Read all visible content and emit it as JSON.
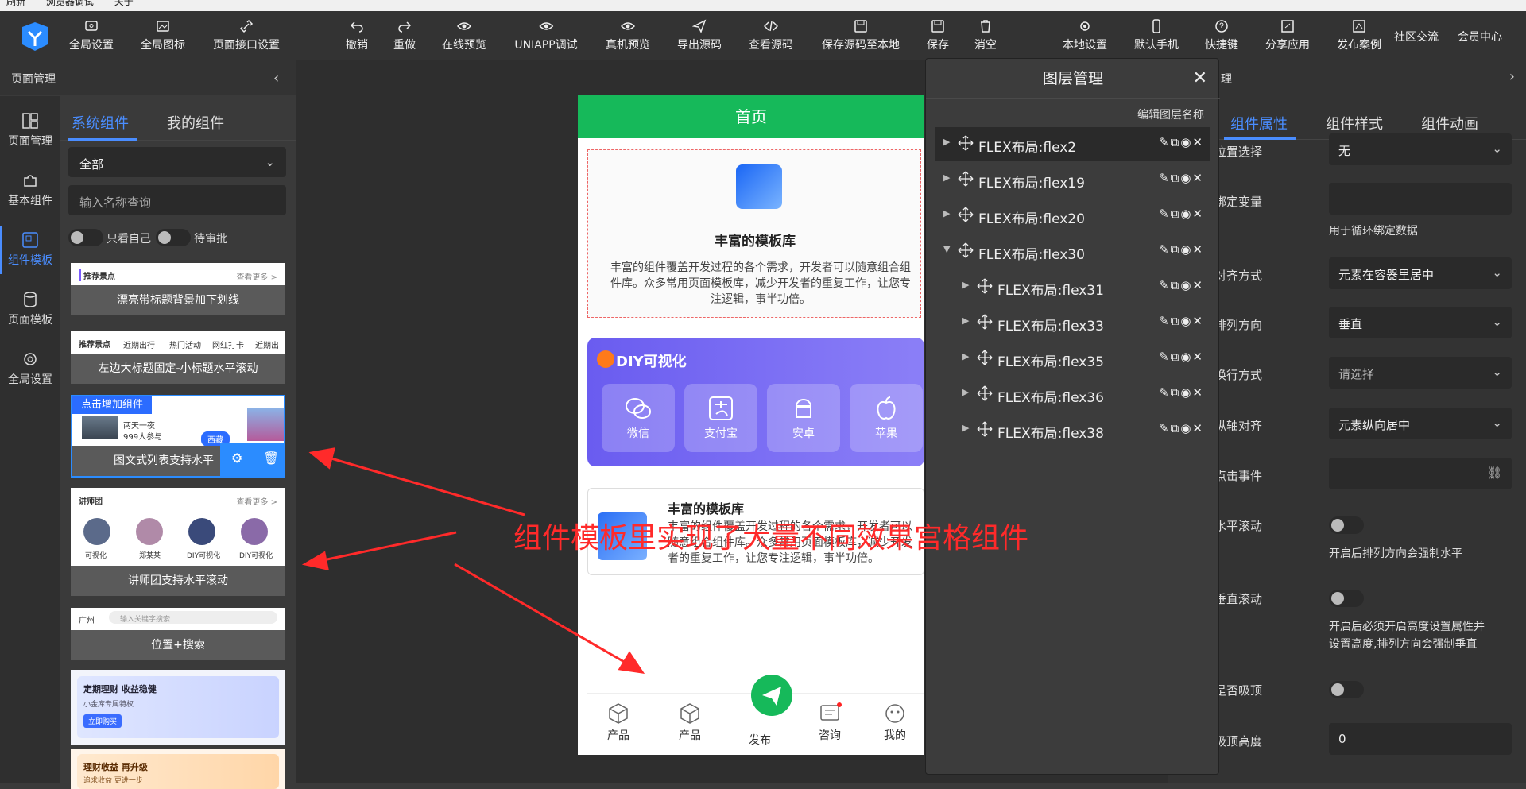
{
  "menubar": {
    "items": [
      "刷新",
      "浏览器调试",
      "关于"
    ]
  },
  "toolbar": {
    "left": [
      "全局设置",
      "全局图标",
      "页面接口设置"
    ],
    "center": [
      "撤销",
      "重做",
      "在线预览",
      "UNIAPP调试",
      "真机预览",
      "导出源码",
      "查看源码",
      "保存源码至本地",
      "保存",
      "消空"
    ],
    "right": [
      "本地设置",
      "默认手机",
      "快捷键",
      "分享应用",
      "发布案例"
    ],
    "links": [
      "社区交流",
      "会员中心"
    ]
  },
  "left_panel": {
    "title": "页面管理",
    "nav": [
      "页面管理",
      "基本组件",
      "组件模板",
      "页面模板",
      "全局设置"
    ],
    "active_nav": "组件模板",
    "tabs": [
      "系统组件",
      "我的组件"
    ],
    "filter_value": "全部",
    "search_placeholder": "输入名称查询",
    "toggle1": "只看自己",
    "toggle2": "待审批",
    "cards": [
      {
        "caption": "漂亮带标题背景加下划线",
        "mini1": "推荐景点",
        "mini2": "查看更多 >"
      },
      {
        "caption": "左边大标题固定-小标题水平滚动",
        "mini1": "推荐景点",
        "mini2": "近期出行",
        "mini3": "热门活动",
        "mini4": "网红打卡",
        "mini5": "近期出"
      },
      {
        "caption": "图文式列表支持水平",
        "badge": "点击增加组件",
        "mini1": "两天一夜",
        "mini2": "999人参与",
        "mini3": "西藏"
      },
      {
        "caption": "讲师团支持水平滚动",
        "mini1": "讲师团",
        "mini2": "查看更多 >",
        "names": [
          "可视化",
          "郑某某",
          "DIY可视化",
          "DIY可视化"
        ]
      },
      {
        "caption": "位置+搜索",
        "mini1": "广州",
        "mini2": "输入关键字搜索"
      },
      {
        "caption": "",
        "mini1": "定期理财 收益稳健",
        "mini2": "小金库专属特权",
        "mini3": "立即购买"
      },
      {
        "caption": "",
        "mini1": "理财收益 再升级",
        "mini2": "追求收益 更进一步"
      }
    ]
  },
  "phone": {
    "title": "首页",
    "box1_title": "丰富的模板库",
    "box1_desc": "丰富的组件覆盖开发过程的各个需求，开发者可以随意组合组件库。众多常用页面模板库，减少开发者的重复工作，让您专注逻辑，事半功倍。",
    "diy_title": "DIY可视化",
    "diy_tiles": [
      "微信",
      "支付宝",
      "安卓",
      "苹果"
    ],
    "box3_title": "丰富的模板库",
    "box3_desc": "丰富的组件覆盖开发过程的各个需求，开发者可以随意组合组件库。众多常用页面模板库，减少开发者的重复工作，让您专注逻辑，事半功倍。",
    "tabbar": [
      "产品",
      "产品",
      "发布",
      "咨询",
      "我的"
    ]
  },
  "layers": {
    "title": "图层管理",
    "edit_label": "编辑图层名称",
    "rows": [
      {
        "label": "FLEX布局:flex2"
      },
      {
        "label": "FLEX布局:flex19"
      },
      {
        "label": "FLEX布局:flex20"
      },
      {
        "label": "FLEX布局:flex30"
      },
      {
        "label": "FLEX布局:flex31"
      },
      {
        "label": "FLEX布局:flex33"
      },
      {
        "label": "FLEX布局:flex35"
      },
      {
        "label": "FLEX布局:flex36"
      },
      {
        "label": "FLEX布局:flex38"
      }
    ]
  },
  "right_panel": {
    "head_fragment": "理",
    "tabs": [
      "组件属性",
      "组件样式",
      "组件动画"
    ],
    "fields": {
      "position": {
        "label": "位置选择",
        "value": "无"
      },
      "bind": {
        "label": "绑定变量",
        "hint": "用于循环绑定数据"
      },
      "align": {
        "label": "对齐方式",
        "value": "元素在容器里居中"
      },
      "direction": {
        "label": "排列方向",
        "value": "垂直"
      },
      "wrap": {
        "label": "换行方式",
        "value": "请选择"
      },
      "cross": {
        "label": "纵轴对齐",
        "value": "元素纵向居中"
      },
      "click": {
        "label": "点击事件"
      },
      "hscroll": {
        "label": "水平滚动",
        "hint": "开启后排列方向会强制水平"
      },
      "vscroll": {
        "label": "垂直滚动",
        "hint1": "开启后必须开启高度设置属性并",
        "hint2": "设置高度,排列方向会强制垂直"
      },
      "sticky": {
        "label": "是否吸顶"
      },
      "sticky_height": {
        "label": "吸顶高度",
        "value": "0"
      }
    }
  },
  "annotation": "组件模板里实现了大量不同效果宫格组件",
  "colors": {
    "accent": "#4a8dff",
    "brand_green": "#16b95a",
    "annotation_red": "#ff2a2a"
  }
}
